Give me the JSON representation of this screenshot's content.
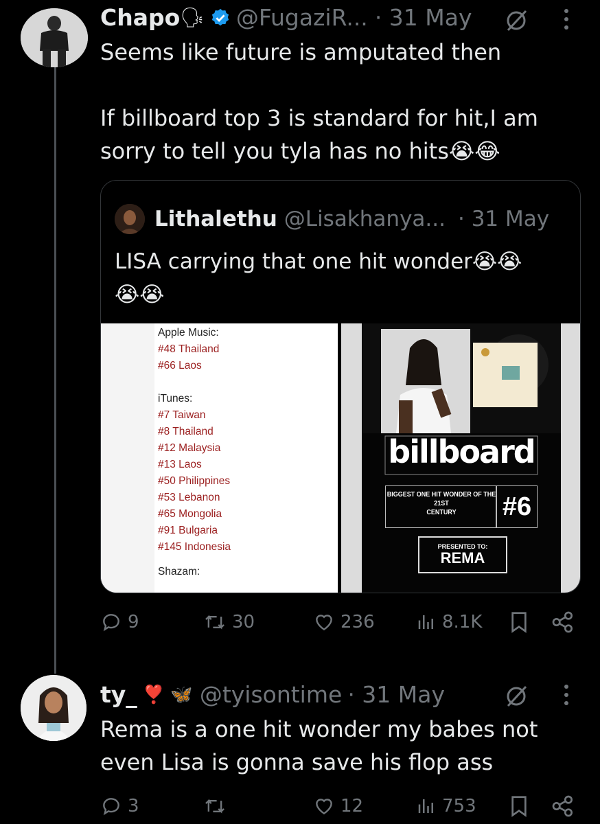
{
  "tweet1": {
    "name": "Chapo",
    "name_emoji": "🗣",
    "handle": "@FugaziR...",
    "date": "· 31 May",
    "text_line1": "Seems like future is amputated then",
    "text_line2": "If billboard top 3 is standard for hit,I am",
    "text_line3": "sorry to tell you tyla has no hits😭😂",
    "quote": {
      "name": "Lithalethu",
      "handle": "@Lisakhanya...",
      "date": "· 31 May",
      "text_line1": "LISA carrying that one hit wonder😭😭",
      "text_line2": "😭😭",
      "chart_list": {
        "apple_header": "Apple Music:",
        "apple_items": [
          "#48 Thailand",
          "#66 Laos"
        ],
        "itunes_header": "iTunes:",
        "itunes_items": [
          "#7 Taiwan",
          "#8 Thailand",
          "#12 Malaysia",
          "#13 Laos",
          "#50 Philippines",
          "#53 Lebanon",
          "#65 Mongolia",
          "#91 Bulgaria",
          "#145 Indonesia"
        ],
        "shazam_header": "Shazam:"
      },
      "billboard": {
        "logo": "billboard",
        "award_line1": "BIGGEST ONE HIT WONDER OF THE 21ST",
        "award_line2": "CENTURY",
        "rank": "#6",
        "presented_label": "PRESENTED TO:",
        "presented_name": "REMA"
      }
    },
    "actions": {
      "replies": "9",
      "retweets": "30",
      "likes": "236",
      "views": "8.1K"
    }
  },
  "tweet2": {
    "name": "ty_",
    "name_emoji": "❣️ 🦋",
    "handle": "@tyisontime",
    "date": "· 31 May",
    "text_line1": "Rema is a one hit wonder my babes not",
    "text_line2": "even Lisa is gonna save his flop ass",
    "actions": {
      "replies": "3",
      "retweets": "",
      "likes": "12",
      "views": "753"
    }
  },
  "colors": {
    "background": "#000000",
    "text": "#e7e9ea",
    "muted": "#71767b",
    "verified": "#1d9bf0",
    "list_red": "#9b1f1f"
  },
  "icons": [
    "grok-slash-icon",
    "more-icon",
    "reply-icon",
    "retweet-icon",
    "like-icon",
    "views-icon",
    "bookmark-icon",
    "share-icon",
    "verified-icon"
  ]
}
